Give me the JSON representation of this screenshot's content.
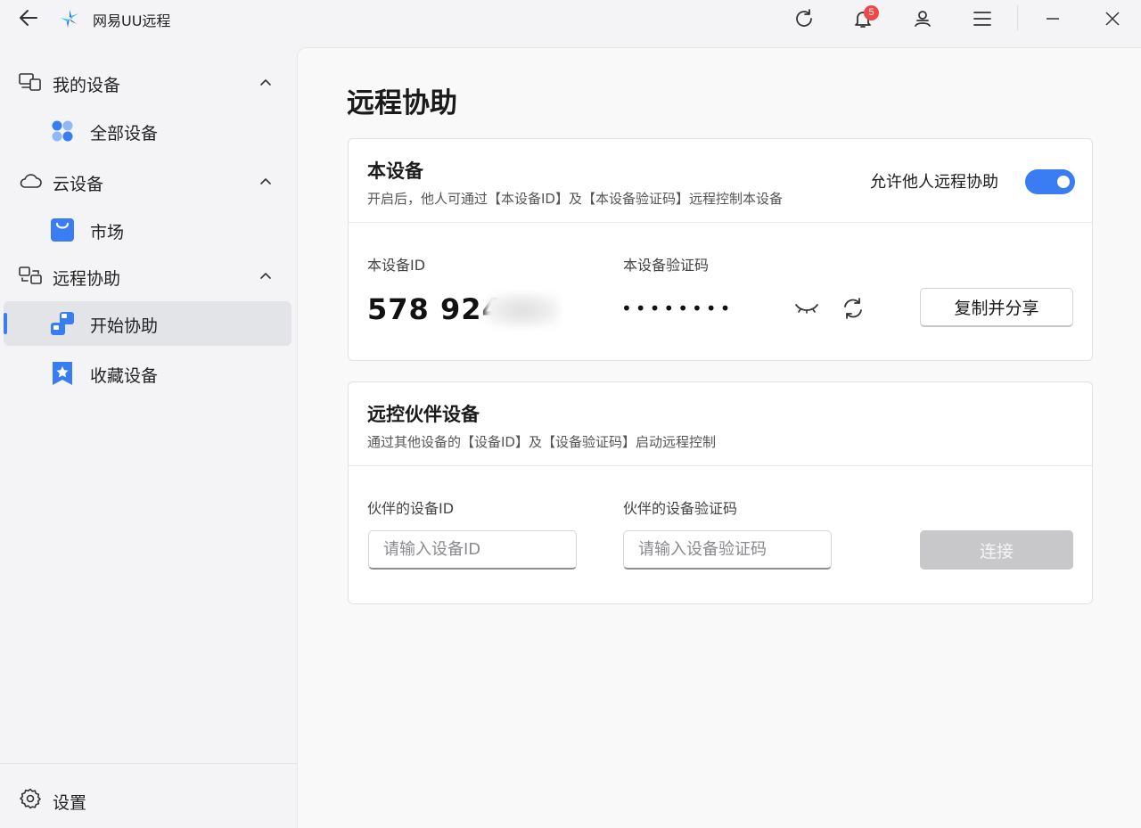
{
  "app": {
    "title": "网易UU远程",
    "notification_count": "5",
    "colors": {
      "accent": "#3a7df2",
      "badge": "#f04848"
    }
  },
  "titlebar": {
    "icons": [
      "back-arrow-icon",
      "app-logo-icon",
      "refresh-icon",
      "bell-icon",
      "user-icon",
      "menu-icon",
      "minimize-icon",
      "close-icon"
    ]
  },
  "sidebar": {
    "groups": [
      {
        "label": "我的设备",
        "icon": "devices-icon",
        "items": [
          {
            "label": "全部设备",
            "icon": "grid-dots-icon"
          }
        ]
      },
      {
        "label": "云设备",
        "icon": "cloud-icon",
        "items": [
          {
            "label": "市场",
            "icon": "shopping-bag-icon"
          }
        ]
      },
      {
        "label": "远程协助",
        "icon": "remote-assist-icon",
        "items": [
          {
            "label": "开始协助",
            "icon": "start-assist-icon",
            "active": true
          },
          {
            "label": "收藏设备",
            "icon": "bookmark-star-icon"
          }
        ]
      }
    ],
    "settings_label": "设置"
  },
  "main": {
    "page_title": "远程协助",
    "this_device": {
      "title": "本设备",
      "desc": "开启后，他人可通过【本设备ID】及【本设备验证码】远程控制本设备",
      "toggle_label": "允许他人远程协助",
      "toggle_on": true,
      "id_label": "本设备ID",
      "id_value": "578 924",
      "code_label": "本设备验证码",
      "code_value": "••••••••",
      "share_button": "复制并分享"
    },
    "partner": {
      "title": "远控伙伴设备",
      "desc": "通过其他设备的【设备ID】及【设备验证码】启动远程控制",
      "id_label": "伙伴的设备ID",
      "id_placeholder": "请输入设备ID",
      "code_label": "伙伴的设备验证码",
      "code_placeholder": "请输入设备验证码",
      "connect_button": "连接"
    }
  }
}
